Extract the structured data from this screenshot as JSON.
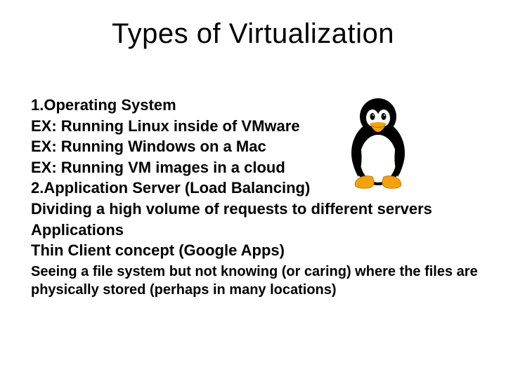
{
  "title": "Types of Virtualization",
  "lines": {
    "l1": "1.Operating System",
    "l2": "EX: Running Linux inside of VMware",
    "l3": "EX: Running Windows on a Mac",
    "l4": "EX: Running VM images in a cloud",
    "l5": "2.Application Server (Load Balancing)",
    "l6": "Dividing a high volume of requests to different servers",
    "l7": "Applications",
    "l8": "Thin Client concept (Google Apps)",
    "l9": "Seeing a file system but not knowing (or caring) where the files  are physically stored (perhaps in many locations)"
  },
  "image": {
    "name": "tux-penguin"
  }
}
